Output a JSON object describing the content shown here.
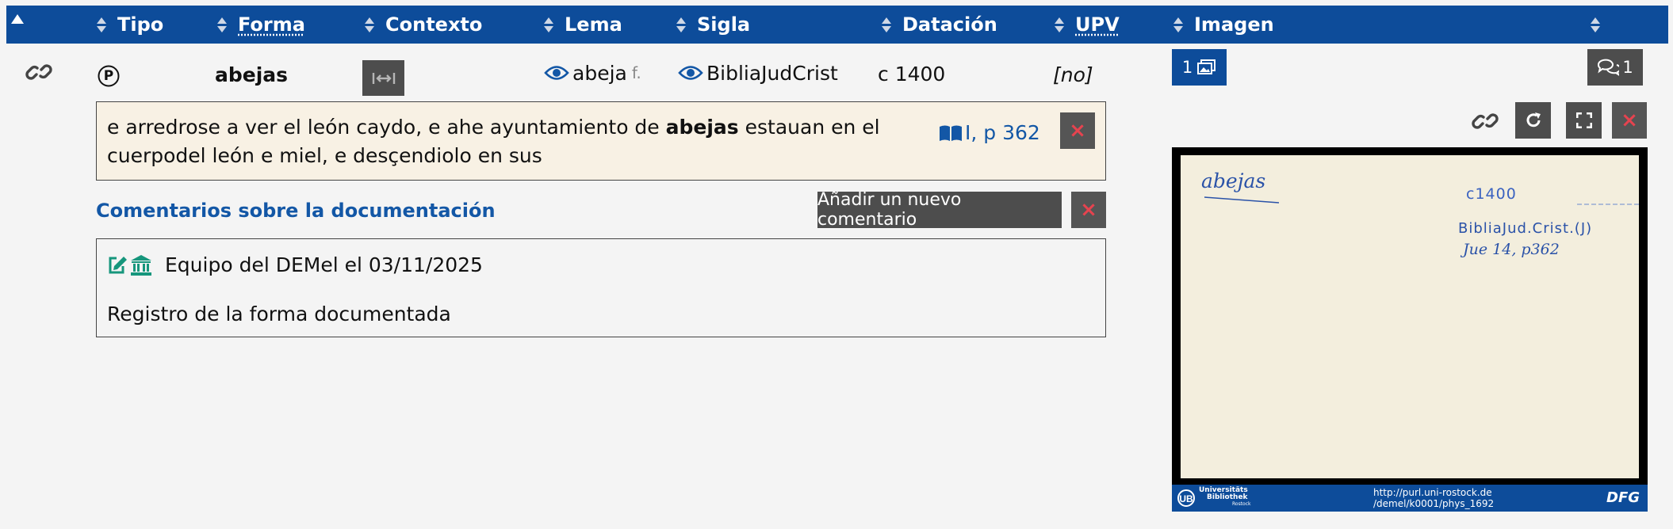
{
  "header": {
    "columns": [
      {
        "label": "Tipo",
        "underline": false
      },
      {
        "label": "Forma",
        "underline": true
      },
      {
        "label": "Contexto",
        "underline": false
      },
      {
        "label": "Lema",
        "underline": false
      },
      {
        "label": "Sigla",
        "underline": false
      },
      {
        "label": "Datación",
        "underline": false
      },
      {
        "label": "UPV",
        "underline": true
      },
      {
        "label": "Imagen",
        "underline": false
      }
    ]
  },
  "row": {
    "tipo_symbol": "P",
    "forma": "abejas",
    "lema_word": "abeja",
    "lema_pos": "f.",
    "sigla": "BibliaJudCrist",
    "datacion": "c 1400",
    "upv": "[no]",
    "image_count": "1",
    "comment_count": "1"
  },
  "citation": {
    "text_before": "e arredrose a ver el león caydo, e ahe ayuntamiento de ",
    "text_bold": "abejas",
    "text_after": " estauan en el cuerpodel león e miel, e desçendiolo en sus",
    "reference": "I, p 362"
  },
  "comments": {
    "heading": "Comentarios sobre la documentación",
    "add_button": "Añadir un nuevo comentario",
    "entry": {
      "author_date": "Equipo del DEMel el 03/11/2025",
      "body": "Registro de la forma documentada"
    }
  },
  "image": {
    "handwriting_word": "abejas",
    "handwriting_date": "c1400",
    "handwriting_source": "BibliaJud.Crist.(J)",
    "handwriting_ref": "Jue 14, p362",
    "footer_logo_line1": "Universitäts",
    "footer_logo_line2": "Bibliothek",
    "footer_logo_line3": "Rostock",
    "footer_url_line1": "http://purl.uni-rostock.de",
    "footer_url_line2": "/demel/k0001/phys_1692",
    "footer_dfg": "DFG"
  },
  "colors": {
    "header_bg": "#0d4c9a",
    "citation_bg": "#f8f1e4",
    "close_red": "#e6434f",
    "link_blue": "#1357a6",
    "icon_green": "#16967c",
    "dark_button": "#4d4d4d"
  }
}
